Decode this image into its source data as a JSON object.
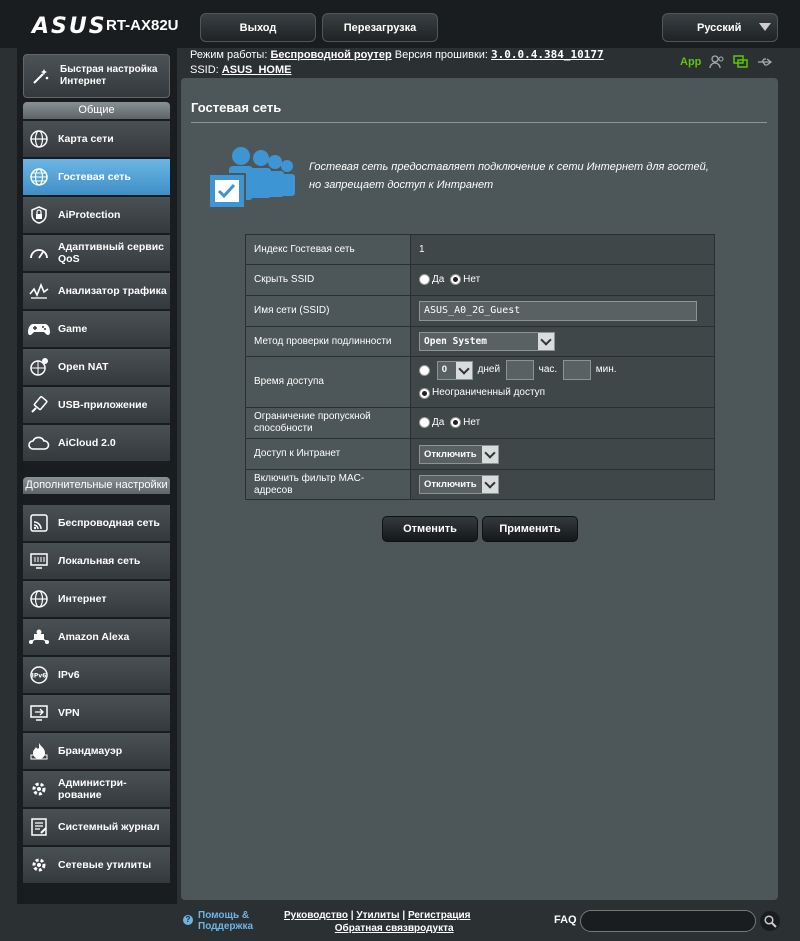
{
  "header": {
    "brand": "ASUS",
    "model": "RT-AX82U",
    "logout_label": "Выход",
    "reboot_label": "Перезагрузка",
    "language": "Русский"
  },
  "status": {
    "mode_label": "Режим работы:",
    "mode_value": "Беспроводной роутер",
    "firmware_label": "Версия прошивки:",
    "firmware_value": "3.0.0.4.384_10177",
    "ssid_label": "SSID:",
    "ssid_value": "ASUS_HOME",
    "app_label": "App"
  },
  "sidebar": {
    "quick_setup": "Быстрая настройка Интернет",
    "general_header": "Общие",
    "general_items": [
      {
        "label": "Карта сети",
        "icon": "network-map-icon"
      },
      {
        "label": "Гостевая сеть",
        "icon": "guest-network-icon"
      },
      {
        "label": "AiProtection",
        "icon": "aiprotection-icon"
      },
      {
        "label": "Адаптивный сервис QoS",
        "icon": "qos-icon"
      },
      {
        "label": "Анализатор трафика",
        "icon": "traffic-analyzer-icon"
      },
      {
        "label": "Game",
        "icon": "game-icon"
      },
      {
        "label": "Open NAT",
        "icon": "open-nat-icon"
      },
      {
        "label": "USB-приложение",
        "icon": "usb-app-icon"
      },
      {
        "label": "AiCloud 2.0",
        "icon": "aicloud-icon"
      }
    ],
    "advanced_header": "Дополнительные настройки",
    "advanced_items": [
      {
        "label": "Беспроводная сеть",
        "icon": "wireless-icon"
      },
      {
        "label": "Локальная сеть",
        "icon": "lan-icon"
      },
      {
        "label": "Интернет",
        "icon": "internet-icon"
      },
      {
        "label": "Amazon Alexa",
        "icon": "alexa-icon"
      },
      {
        "label": "IPv6",
        "icon": "ipv6-icon"
      },
      {
        "label": "VPN",
        "icon": "vpn-icon"
      },
      {
        "label": "Брандмауэр",
        "icon": "firewall-icon"
      },
      {
        "label": "Администри-рование",
        "icon": "administration-icon"
      },
      {
        "label": "Системный журнал",
        "icon": "system-log-icon"
      },
      {
        "label": "Сетевые утилиты",
        "icon": "network-tools-icon"
      }
    ]
  },
  "main": {
    "title": "Гостевая сеть",
    "description_1": "Гостевая сеть предоставляет подключение к сети Интернет для гостей,",
    "description_2": "но запрещает доступ к Интранет",
    "form": {
      "index_label": "Индекс Гостевая сеть",
      "index_value": "1",
      "hide_ssid_label": "Скрыть SSID",
      "yes": "Да",
      "no": "Нет",
      "ssid_name_label": "Имя сети (SSID)",
      "ssid_name_value": "ASUS_A0_2G_Guest",
      "auth_label": "Метод проверки подлинности",
      "auth_value": "Open System",
      "access_time_label": "Время доступа",
      "days_value": "0",
      "days_unit": "дней",
      "hours_unit": "час.",
      "minutes_unit": "мин.",
      "unlimited_label": "Неограниченный доступ",
      "bandwidth_label": "Ограничение пропускной способности",
      "intranet_label": "Доступ к Интранет",
      "intranet_value": "Отключить",
      "mac_filter_label": "Включить фильтр MAC-адресов",
      "mac_filter_value": "Отключить"
    },
    "cancel_label": "Отменить",
    "apply_label": "Применить"
  },
  "footer": {
    "help": "Помощь & Поддержка",
    "manual": "Руководство",
    "utilities": "Утилиты",
    "registration": "Регистрация продукта",
    "feedback": "Обратная связь",
    "faq": "FAQ"
  },
  "colors": {
    "accent": "#3f8fc7",
    "background": "#2b3033",
    "panel": "#4d5658",
    "app_green": "#5ec40e"
  }
}
